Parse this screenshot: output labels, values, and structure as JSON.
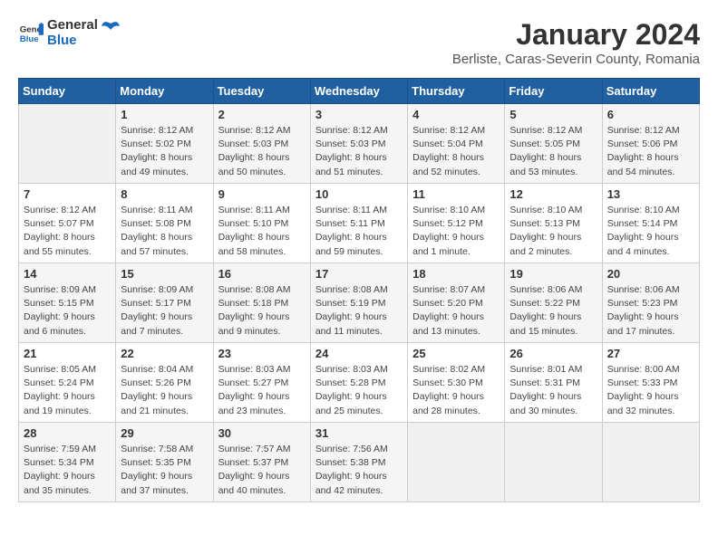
{
  "header": {
    "logo_general": "General",
    "logo_blue": "Blue",
    "month_year": "January 2024",
    "location": "Berliste, Caras-Severin County, Romania"
  },
  "days_of_week": [
    "Sunday",
    "Monday",
    "Tuesday",
    "Wednesday",
    "Thursday",
    "Friday",
    "Saturday"
  ],
  "weeks": [
    [
      {
        "day": "",
        "info": ""
      },
      {
        "day": "1",
        "info": "Sunrise: 8:12 AM\nSunset: 5:02 PM\nDaylight: 8 hours\nand 49 minutes."
      },
      {
        "day": "2",
        "info": "Sunrise: 8:12 AM\nSunset: 5:03 PM\nDaylight: 8 hours\nand 50 minutes."
      },
      {
        "day": "3",
        "info": "Sunrise: 8:12 AM\nSunset: 5:03 PM\nDaylight: 8 hours\nand 51 minutes."
      },
      {
        "day": "4",
        "info": "Sunrise: 8:12 AM\nSunset: 5:04 PM\nDaylight: 8 hours\nand 52 minutes."
      },
      {
        "day": "5",
        "info": "Sunrise: 8:12 AM\nSunset: 5:05 PM\nDaylight: 8 hours\nand 53 minutes."
      },
      {
        "day": "6",
        "info": "Sunrise: 8:12 AM\nSunset: 5:06 PM\nDaylight: 8 hours\nand 54 minutes."
      }
    ],
    [
      {
        "day": "7",
        "info": ""
      },
      {
        "day": "8",
        "info": "Sunrise: 8:11 AM\nSunset: 5:08 PM\nDaylight: 8 hours\nand 57 minutes."
      },
      {
        "day": "9",
        "info": "Sunrise: 8:11 AM\nSunset: 5:10 PM\nDaylight: 8 hours\nand 58 minutes."
      },
      {
        "day": "10",
        "info": "Sunrise: 8:11 AM\nSunset: 5:11 PM\nDaylight: 8 hours\nand 59 minutes."
      },
      {
        "day": "11",
        "info": "Sunrise: 8:10 AM\nSunset: 5:12 PM\nDaylight: 9 hours\nand 1 minute."
      },
      {
        "day": "12",
        "info": "Sunrise: 8:10 AM\nSunset: 5:13 PM\nDaylight: 9 hours\nand 2 minutes."
      },
      {
        "day": "13",
        "info": "Sunrise: 8:10 AM\nSunset: 5:14 PM\nDaylight: 9 hours\nand 4 minutes."
      }
    ],
    [
      {
        "day": "14",
        "info": "Sunrise: 8:09 AM\nSunset: 5:15 PM\nDaylight: 9 hours\nand 6 minutes."
      },
      {
        "day": "15",
        "info": "Sunrise: 8:09 AM\nSunset: 5:17 PM\nDaylight: 9 hours\nand 7 minutes."
      },
      {
        "day": "16",
        "info": "Sunrise: 8:08 AM\nSunset: 5:18 PM\nDaylight: 9 hours\nand 9 minutes."
      },
      {
        "day": "17",
        "info": "Sunrise: 8:08 AM\nSunset: 5:19 PM\nDaylight: 9 hours\nand 11 minutes."
      },
      {
        "day": "18",
        "info": "Sunrise: 8:07 AM\nSunset: 5:20 PM\nDaylight: 9 hours\nand 13 minutes."
      },
      {
        "day": "19",
        "info": "Sunrise: 8:06 AM\nSunset: 5:22 PM\nDaylight: 9 hours\nand 15 minutes."
      },
      {
        "day": "20",
        "info": "Sunrise: 8:06 AM\nSunset: 5:23 PM\nDaylight: 9 hours\nand 17 minutes."
      }
    ],
    [
      {
        "day": "21",
        "info": "Sunrise: 8:05 AM\nSunset: 5:24 PM\nDaylight: 9 hours\nand 19 minutes."
      },
      {
        "day": "22",
        "info": "Sunrise: 8:04 AM\nSunset: 5:26 PM\nDaylight: 9 hours\nand 21 minutes."
      },
      {
        "day": "23",
        "info": "Sunrise: 8:03 AM\nSunset: 5:27 PM\nDaylight: 9 hours\nand 23 minutes."
      },
      {
        "day": "24",
        "info": "Sunrise: 8:03 AM\nSunset: 5:28 PM\nDaylight: 9 hours\nand 25 minutes."
      },
      {
        "day": "25",
        "info": "Sunrise: 8:02 AM\nSunset: 5:30 PM\nDaylight: 9 hours\nand 28 minutes."
      },
      {
        "day": "26",
        "info": "Sunrise: 8:01 AM\nSunset: 5:31 PM\nDaylight: 9 hours\nand 30 minutes."
      },
      {
        "day": "27",
        "info": "Sunrise: 8:00 AM\nSunset: 5:33 PM\nDaylight: 9 hours\nand 32 minutes."
      }
    ],
    [
      {
        "day": "28",
        "info": "Sunrise: 7:59 AM\nSunset: 5:34 PM\nDaylight: 9 hours\nand 35 minutes."
      },
      {
        "day": "29",
        "info": "Sunrise: 7:58 AM\nSunset: 5:35 PM\nDaylight: 9 hours\nand 37 minutes."
      },
      {
        "day": "30",
        "info": "Sunrise: 7:57 AM\nSunset: 5:37 PM\nDaylight: 9 hours\nand 40 minutes."
      },
      {
        "day": "31",
        "info": "Sunrise: 7:56 AM\nSunset: 5:38 PM\nDaylight: 9 hours\nand 42 minutes."
      },
      {
        "day": "",
        "info": ""
      },
      {
        "day": "",
        "info": ""
      },
      {
        "day": "",
        "info": ""
      }
    ]
  ],
  "week7_sunday_info": "Sunrise: 8:12 AM\nSunset: 5:07 PM\nDaylight: 8 hours\nand 55 minutes."
}
